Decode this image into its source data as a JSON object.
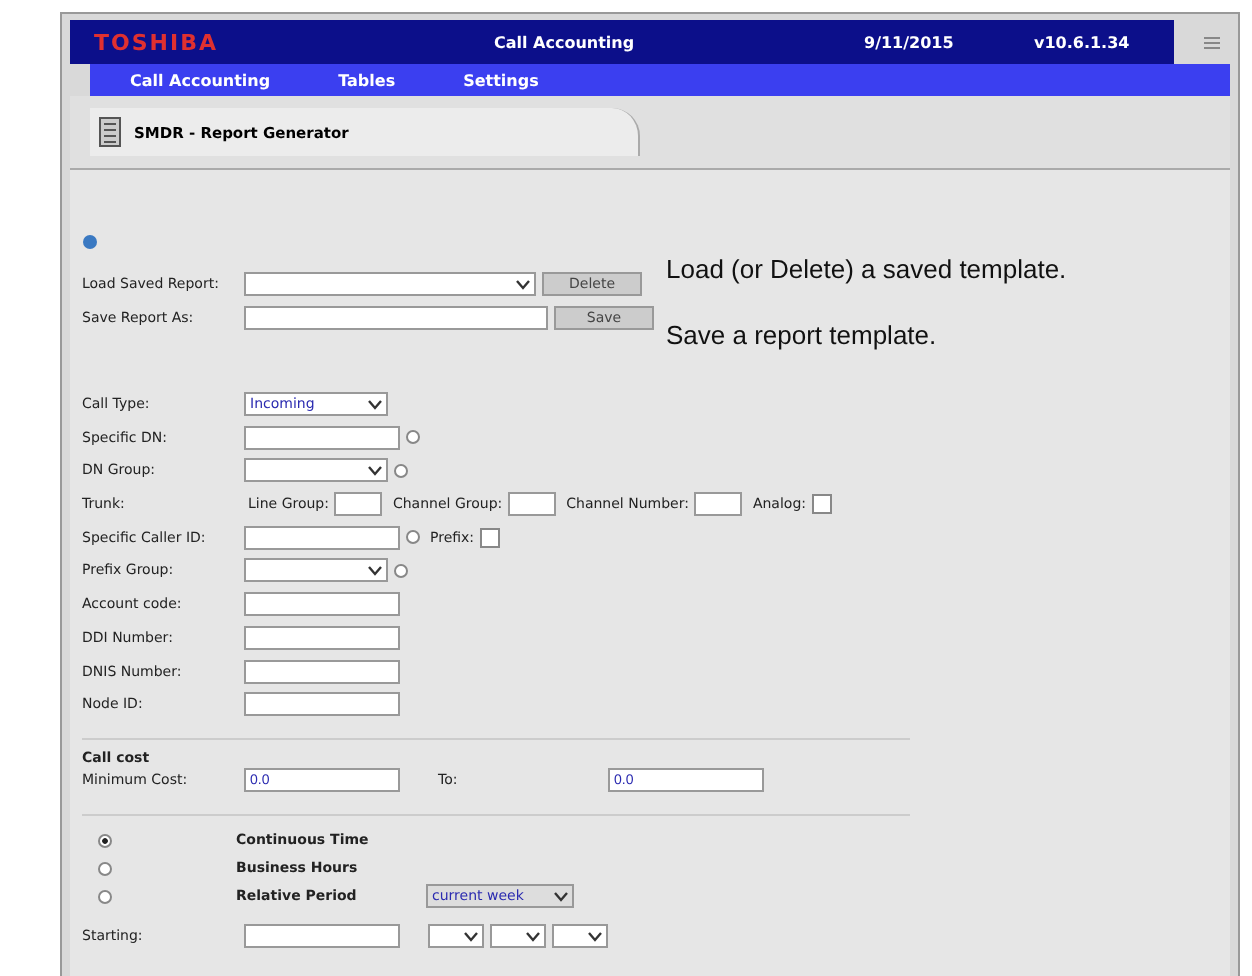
{
  "header": {
    "logo": "TOSHIBA",
    "title": "Call Accounting",
    "date": "9/11/2015",
    "version": "v10.6.1.34"
  },
  "menu": [
    {
      "label": "Call Accounting"
    },
    {
      "label": "Tables"
    },
    {
      "label": "Settings"
    }
  ],
  "page_tab": {
    "title": "SMDR - Report Generator"
  },
  "templates": [
    {
      "label": "Load Saved Report:",
      "kind": "select",
      "button": "Delete"
    },
    {
      "label": "Save Report As:",
      "kind": "text",
      "button": "Save"
    }
  ],
  "filters": [
    {
      "label": "Call Type:",
      "kind": "select",
      "value": "Incoming"
    },
    {
      "label": "Specific DN:",
      "kind": "text",
      "radio_selected": false
    },
    {
      "label": "DN Group:",
      "kind": "select",
      "radio_selected": false
    },
    {
      "label": "Trunk:",
      "kind": "trunk",
      "parts": [
        {
          "label": "Line Group:",
          "kind": "text"
        },
        {
          "label": "Channel Group:",
          "kind": "text"
        },
        {
          "label": "Channel Number:",
          "kind": "text"
        },
        {
          "label": "Analog:",
          "kind": "check",
          "checked": false
        }
      ]
    },
    {
      "label": "Specific Caller ID:",
      "kind": "text",
      "radio_selected": false,
      "parts": [
        {
          "label": "Prefix:",
          "kind": "check",
          "checked": false
        }
      ]
    },
    {
      "label": "Prefix Group:",
      "kind": "select",
      "radio_selected": false
    },
    {
      "label": "Account code:",
      "kind": "text"
    },
    {
      "label": "DDI Number:",
      "kind": "text"
    },
    {
      "label": "DNIS Number:",
      "kind": "text"
    },
    {
      "label": "Node ID:",
      "kind": "text"
    }
  ],
  "call_cost": {
    "heading": "Call cost",
    "min_label": "Minimum Cost:",
    "min_value": "0.0",
    "to_label": "To:",
    "to_value": "0.0"
  },
  "periods": [
    {
      "label": "Continuous Time",
      "selected": true
    },
    {
      "label": "Business Hours",
      "selected": false
    },
    {
      "label": "Relative Period",
      "selected": false,
      "select": "current week"
    }
  ],
  "starting": {
    "label": "Starting:"
  },
  "notes": [
    "Load (or Delete) a saved template.",
    "Save a report template."
  ]
}
